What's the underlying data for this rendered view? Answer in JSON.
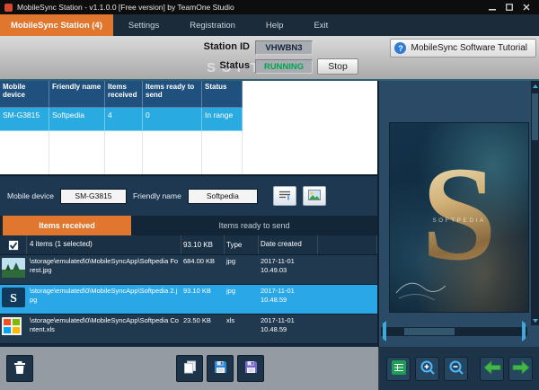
{
  "window": {
    "title": "MobileSync Station - v1.1.0.0 [Free version] by TeamOne Studio"
  },
  "menu": {
    "tabs": [
      {
        "label": "MobileSync Station (4)",
        "active": true
      },
      {
        "label": "Settings",
        "active": false
      },
      {
        "label": "Registration",
        "active": false
      },
      {
        "label": "Help",
        "active": false
      },
      {
        "label": "Exit",
        "active": false
      }
    ]
  },
  "header": {
    "station_id_label": "Station ID",
    "station_id_value": "VHWBN3",
    "status_label": "Status",
    "status_value": "RUNNING",
    "stop_button_label": "Stop",
    "tutorial_button_label": "MobileSync Software Tutorial",
    "watermark": "SOFTPEDIA"
  },
  "device_table": {
    "columns": [
      "Mobile device",
      "Friendly name",
      "Items received",
      "Items ready to send",
      "Status"
    ],
    "rows": [
      {
        "mobile_device": "SM-G3815",
        "friendly_name": "Softpedia",
        "items_received": "4",
        "items_ready_to_send": "0",
        "status": "In range"
      }
    ]
  },
  "device_bar": {
    "mobile_device_label": "Mobile device",
    "mobile_device_value": "SM-G3815",
    "friendly_name_label": "Friendly name",
    "friendly_name_value": "Softpedia"
  },
  "file_tabs": {
    "items_received_label": "Items received",
    "items_ready_label": "Items ready to send"
  },
  "file_table": {
    "header": {
      "selection_summary": "4 items (1 selected)",
      "size": "93.10 KB",
      "type": "Type",
      "date_created": "Date created"
    },
    "rows": [
      {
        "path": "\\storage\\emulated\\0\\MobileSyncApp\\Softpedia Forest.jpg",
        "size": "684.00 KB",
        "type": "jpg",
        "date_created": "2017-11-01 10.49.03",
        "selected": false
      },
      {
        "path": "\\storage\\emulated\\0\\MobileSyncApp\\Softpedia 2.jpg",
        "size": "93.10 KB",
        "type": "jpg",
        "date_created": "2017-11-01 10.48.59",
        "selected": true
      },
      {
        "path": "\\storage\\emulated\\0\\MobileSyncApp\\Softpedia Content.xls",
        "size": "23.50 KB",
        "type": "xls",
        "date_created": "2017-11-01 10.48.59",
        "selected": false
      }
    ]
  },
  "preview": {
    "letter": "S",
    "watermark": "SOFTPEDIA"
  },
  "colors": {
    "accent_orange": "#e1762e",
    "selection_blue": "#29abe2",
    "running_green": "#00a651",
    "table_header_blue": "#20507e",
    "panel_navy": "#1d3348",
    "toolbar_gray": "#949ba3"
  },
  "icons": {
    "titlebar": [
      "app-icon",
      "minimize-icon",
      "maximize-icon",
      "close-icon"
    ],
    "header": [
      "question-icon"
    ],
    "device_bar": [
      "rename-icon",
      "image-icon"
    ],
    "file_list": [
      "checkbox-checked-icon",
      "forest-photo-thumb",
      "s-logo-thumb",
      "xls-file-icon"
    ],
    "left_toolbar": [
      "trash-icon",
      "copy-icon",
      "save-icon",
      "save-alt-icon"
    ],
    "right_toolbar": [
      "export-excel-icon",
      "zoom-in-icon",
      "zoom-out-icon",
      "back-arrow-icon",
      "forward-arrow-icon"
    ],
    "scrollbars": [
      "scroll-up-icon",
      "scroll-down-icon",
      "scroll-left-icon",
      "scroll-right-icon"
    ]
  }
}
